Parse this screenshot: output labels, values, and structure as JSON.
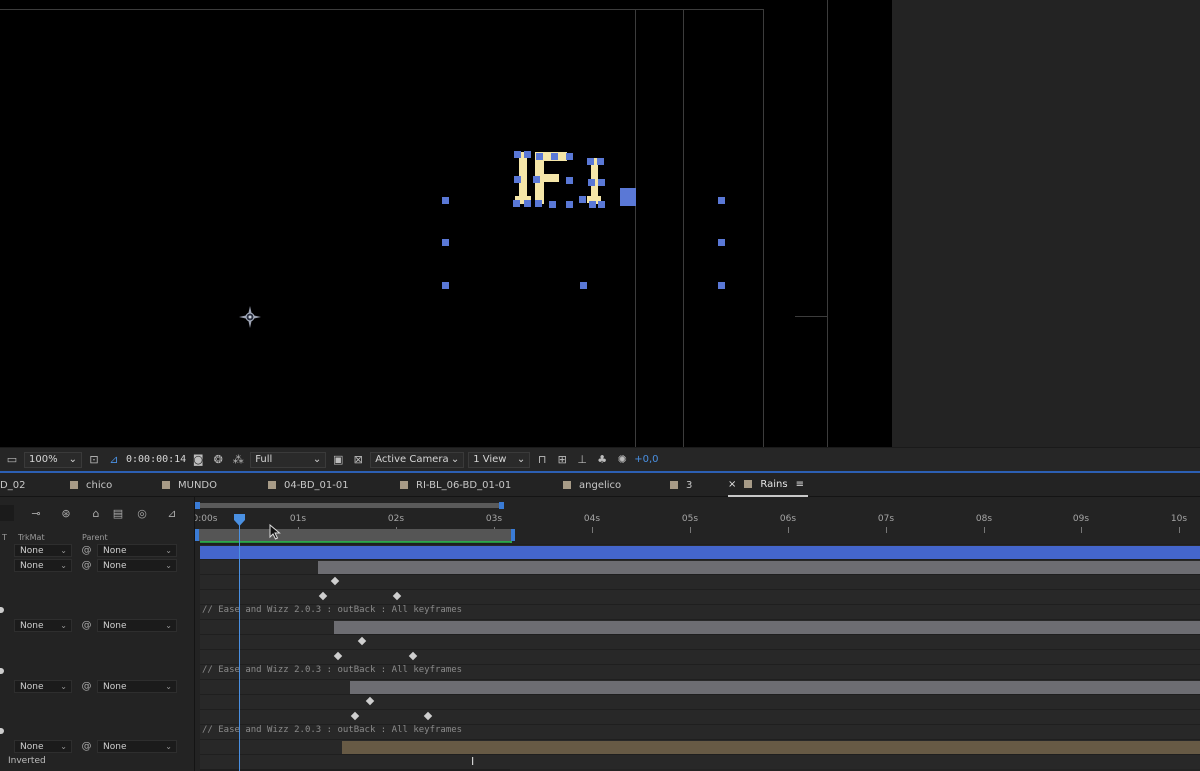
{
  "viewer_toolbar": {
    "zoom": "100%",
    "timecode": "0:00:00:14",
    "resolution": "Full",
    "camera": "Active Camera",
    "view_layout": "1 View",
    "exposure": "+0,0"
  },
  "tabs": [
    {
      "label": "D_02"
    },
    {
      "label": "chico"
    },
    {
      "label": "MUNDO"
    },
    {
      "label": "04-BD_01-01"
    },
    {
      "label": "RI-BL_06-BD_01-01"
    },
    {
      "label": "angelico"
    },
    {
      "label": "3"
    },
    {
      "label": "Rains",
      "close": "×",
      "menu": "≡"
    }
  ],
  "columns": {
    "trkmat": "TrkMat",
    "parent": "Parent",
    "t": "T"
  },
  "layers": [
    {
      "trkmat": "None",
      "parent": "None"
    },
    {
      "trkmat": "None",
      "parent": "None"
    },
    {
      "trkmat": "None",
      "parent": "None"
    },
    {
      "trkmat": "None",
      "parent": "None"
    },
    {
      "trkmat": "None",
      "parent": "None"
    }
  ],
  "ruler": [
    "0:00s",
    "01s",
    "02s",
    "03s",
    "04s",
    "05s",
    "06s",
    "07s",
    "08s",
    "09s",
    "10s"
  ],
  "expressions": [
    "// Ease and Wizz 2.0.3 : outBack : All keyframes",
    "// Ease and Wizz 2.0.3 : outBack : All keyframes",
    "// Ease and Wizz 2.0.3 : outBack : All keyframes"
  ],
  "status": {
    "bottom_label": "Inverted"
  },
  "colors": {
    "accent": "#4a90e2",
    "bar_blue": "#4466cc",
    "bar_gray": "#6d6d72",
    "bar_tan": "#675a45",
    "handle": "#5a78d6"
  }
}
